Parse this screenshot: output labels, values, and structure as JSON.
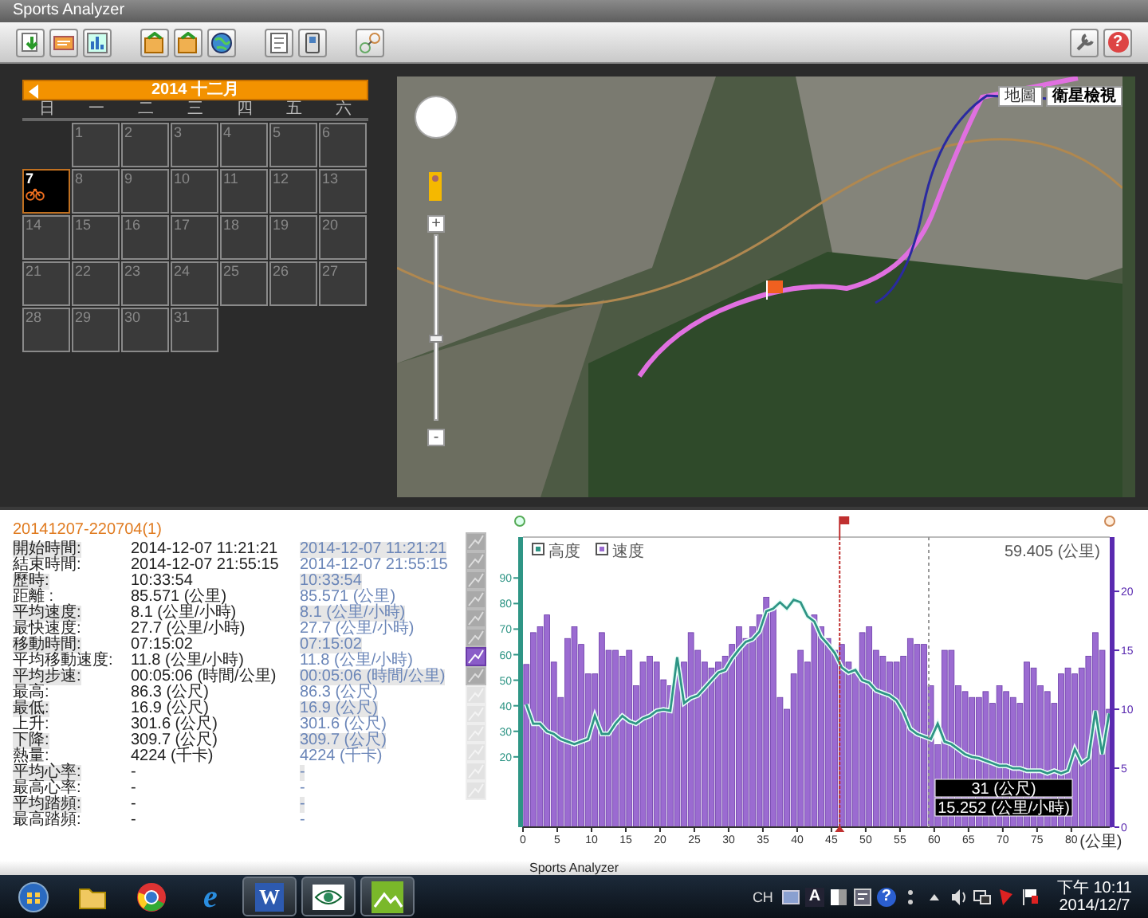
{
  "window": {
    "title": "Sports Analyzer"
  },
  "toolbar": {
    "groups": [
      [
        {
          "kind": "import"
        },
        {
          "kind": "card"
        },
        {
          "kind": "chart"
        }
      ],
      [
        {
          "kind": "export"
        },
        {
          "kind": "export"
        },
        {
          "kind": "globe"
        }
      ],
      [
        {
          "kind": "document"
        },
        {
          "kind": "device"
        }
      ],
      [
        {
          "kind": "chain"
        }
      ]
    ],
    "right": [
      {
        "kind": "wrench"
      },
      {
        "kind": "help",
        "glyph": "?"
      }
    ]
  },
  "calendar": {
    "month": "2014 十二月",
    "weekdays": [
      "日",
      "一",
      "二",
      "三",
      "四",
      "五",
      "六"
    ],
    "weeks": [
      [
        {
          "kind": "blank"
        },
        {
          "kind": "day",
          "day": "1",
          "selected": false,
          "has_activity": false
        },
        {
          "kind": "day",
          "day": "2",
          "selected": false,
          "has_activity": false
        },
        {
          "kind": "day",
          "day": "3",
          "selected": false,
          "has_activity": false
        },
        {
          "kind": "day",
          "day": "4",
          "selected": false,
          "has_activity": false
        },
        {
          "kind": "day",
          "day": "5",
          "selected": false,
          "has_activity": false
        },
        {
          "kind": "day",
          "day": "6",
          "selected": false,
          "has_activity": false
        }
      ],
      [
        {
          "kind": "day",
          "day": "7",
          "selected": true,
          "has_activity": true
        },
        {
          "kind": "day",
          "day": "8",
          "selected": false,
          "has_activity": false
        },
        {
          "kind": "day",
          "day": "9",
          "selected": false,
          "has_activity": false
        },
        {
          "kind": "day",
          "day": "10",
          "selected": false,
          "has_activity": false
        },
        {
          "kind": "day",
          "day": "11",
          "selected": false,
          "has_activity": false
        },
        {
          "kind": "day",
          "day": "12",
          "selected": false,
          "has_activity": false
        },
        {
          "kind": "day",
          "day": "13",
          "selected": false,
          "has_activity": false
        }
      ],
      [
        {
          "kind": "day",
          "day": "14",
          "selected": false,
          "has_activity": false
        },
        {
          "kind": "day",
          "day": "15",
          "selected": false,
          "has_activity": false
        },
        {
          "kind": "day",
          "day": "16",
          "selected": false,
          "has_activity": false
        },
        {
          "kind": "day",
          "day": "17",
          "selected": false,
          "has_activity": false
        },
        {
          "kind": "day",
          "day": "18",
          "selected": false,
          "has_activity": false
        },
        {
          "kind": "day",
          "day": "19",
          "selected": false,
          "has_activity": false
        },
        {
          "kind": "day",
          "day": "20",
          "selected": false,
          "has_activity": false
        }
      ],
      [
        {
          "kind": "day",
          "day": "21",
          "selected": false,
          "has_activity": false
        },
        {
          "kind": "day",
          "day": "22",
          "selected": false,
          "has_activity": false
        },
        {
          "kind": "day",
          "day": "23",
          "selected": false,
          "has_activity": false
        },
        {
          "kind": "day",
          "day": "24",
          "selected": false,
          "has_activity": false
        },
        {
          "kind": "day",
          "day": "25",
          "selected": false,
          "has_activity": false
        },
        {
          "kind": "day",
          "day": "26",
          "selected": false,
          "has_activity": false
        },
        {
          "kind": "day",
          "day": "27",
          "selected": false,
          "has_activity": false
        }
      ],
      [
        {
          "kind": "day",
          "day": "28",
          "selected": false,
          "has_activity": false
        },
        {
          "kind": "day",
          "day": "29",
          "selected": false,
          "has_activity": false
        },
        {
          "kind": "day",
          "day": "30",
          "selected": false,
          "has_activity": false
        },
        {
          "kind": "day",
          "day": "31",
          "selected": false,
          "has_activity": false
        }
      ]
    ]
  },
  "map": {
    "zoom_in": "+",
    "zoom_out": "-",
    "zoom_slider": {
      "level": 0.46
    },
    "map_types": [
      {
        "label": "地圖",
        "selected": false
      },
      {
        "label": "衛星檢視",
        "selected": true
      }
    ]
  },
  "session": {
    "title": "20141207-220704(1)",
    "rows": [
      {
        "label": "開始時間:",
        "value": "2014-12-07 11:21:21",
        "compare": "2014-12-07 11:21:21"
      },
      {
        "label": "結束時間:",
        "value": "2014-12-07 21:55:15",
        "compare": "2014-12-07 21:55:15"
      },
      {
        "label": "歷時:",
        "value": "10:33:54",
        "compare": "10:33:54"
      },
      {
        "label": "距離 :",
        "value": "85.571 (公里)",
        "compare": "85.571 (公里)"
      },
      {
        "label": "平均速度:",
        "value": "8.1 (公里/小時)",
        "compare": "8.1 (公里/小時)"
      },
      {
        "label": "最快速度:",
        "value": "27.7 (公里/小時)",
        "compare": "27.7 (公里/小時)"
      },
      {
        "label": "移動時間:",
        "value": "07:15:02",
        "compare": "07:15:02"
      },
      {
        "label": "平均移動速度:",
        "value": "11.8 (公里/小時)",
        "compare": "11.8 (公里/小時)"
      },
      {
        "label": "平均步速:",
        "value": "00:05:06 (時間/公里)",
        "compare": "00:05:06 (時間/公里)"
      },
      {
        "label": "最高:",
        "value": "86.3 (公尺)",
        "compare": "86.3 (公尺)"
      },
      {
        "label": "最低:",
        "value": "16.9 (公尺)",
        "compare": "16.9 (公尺)"
      },
      {
        "label": "上升:",
        "value": "301.6 (公尺)",
        "compare": "301.6 (公尺)"
      },
      {
        "label": "下降:",
        "value": "309.7 (公尺)",
        "compare": "309.7 (公尺)"
      },
      {
        "label": "熱量:",
        "value": "4224 (千卡)",
        "compare": "4224 (千卡)"
      },
      {
        "label": "平均心率:",
        "value": "-",
        "compare": "-"
      },
      {
        "label": "最高心率:",
        "value": "-",
        "compare": "-"
      },
      {
        "label": "平均踏頻:",
        "value": "-",
        "compare": "-"
      },
      {
        "label": "最高踏頻:",
        "value": "-",
        "compare": "-"
      }
    ]
  },
  "chart_tools": [
    {
      "selected": false,
      "disabled": false
    },
    {
      "selected": false,
      "disabled": false
    },
    {
      "selected": false,
      "disabled": false
    },
    {
      "selected": false,
      "disabled": false
    },
    {
      "selected": false,
      "disabled": false
    },
    {
      "selected": false,
      "disabled": false
    },
    {
      "selected": true,
      "disabled": false
    },
    {
      "selected": false,
      "disabled": false
    },
    {
      "selected": false,
      "disabled": true
    },
    {
      "selected": false,
      "disabled": true
    },
    {
      "selected": false,
      "disabled": true
    },
    {
      "selected": false,
      "disabled": true
    },
    {
      "selected": false,
      "disabled": true
    },
    {
      "selected": false,
      "disabled": true
    }
  ],
  "chart": {
    "reading": "59.405 (公里)",
    "tooltip": [
      "31 (公尺)",
      "15.252 (公里/小時)"
    ],
    "chart_data": {
      "type": "bar",
      "xlabel": "(公里)",
      "x": [
        0.5,
        1.5,
        2.5,
        3.5,
        4.5,
        5.5,
        6.5,
        7.5,
        8.5,
        9.5,
        10.5,
        11.5,
        12.5,
        13.5,
        14.5,
        15.5,
        16.5,
        17.5,
        18.5,
        19.5,
        20.5,
        21.5,
        22.5,
        23.5,
        24.5,
        25.5,
        26.5,
        27.5,
        28.5,
        29.5,
        30.5,
        31.5,
        32.5,
        33.5,
        34.5,
        35.5,
        36.5,
        37.5,
        38.5,
        39.5,
        40.5,
        41.5,
        42.5,
        43.5,
        44.5,
        45.5,
        46.5,
        47.5,
        48.5,
        49.5,
        50.5,
        51.5,
        52.5,
        53.5,
        54.5,
        55.5,
        56.5,
        57.5,
        58.5,
        59.5,
        60.5,
        61.5,
        62.5,
        63.5,
        64.5,
        65.5,
        66.5,
        67.5,
        68.5,
        69.5,
        70.5,
        71.5,
        72.5,
        73.5,
        74.5,
        75.5,
        76.5,
        77.5,
        78.5,
        79.5,
        80.5,
        81.5,
        82.5,
        83.5,
        84.5,
        85.5
      ],
      "series": [
        {
          "name": "高度",
          "color": "#2e9585",
          "type": "line",
          "values": [
            40.6,
            33,
            33,
            30,
            29,
            27,
            26,
            25,
            26,
            27,
            36,
            29,
            29,
            33,
            36,
            34,
            33,
            35,
            36,
            38,
            38.5,
            38,
            59,
            41,
            43,
            44,
            47,
            50,
            53,
            54,
            58.5,
            62,
            65,
            66,
            69,
            77,
            78,
            80.5,
            78,
            81.5,
            80.5,
            75,
            73,
            67,
            64,
            60.6,
            55,
            53,
            54,
            50,
            49,
            46,
            45,
            44,
            42,
            37.5,
            31,
            29,
            28,
            27,
            33,
            26,
            25,
            23,
            21,
            20,
            19.5,
            18.5,
            17.5,
            16.5,
            16.5,
            15.5,
            15.5,
            14.6,
            14.6,
            14.6,
            13.5,
            14.6,
            13.5,
            14.6,
            23,
            17.5,
            19.5,
            38,
            21,
            37
          ]
        },
        {
          "name": "速度",
          "color": "#9b6bd1",
          "axis": "y2",
          "values": [
            13.8,
            16.5,
            17,
            18,
            14,
            11,
            16,
            17,
            15.5,
            13,
            13,
            16.5,
            15,
            15,
            14.5,
            15,
            12,
            14,
            14.5,
            14,
            12.5,
            12,
            13,
            14,
            16.5,
            15,
            14,
            13.5,
            14,
            14.5,
            15.5,
            17,
            16,
            17,
            18,
            19.5,
            18.5,
            11,
            10,
            13,
            15,
            14,
            18,
            17,
            16,
            15,
            15.5,
            14,
            13,
            16.5,
            17,
            15,
            14.5,
            14,
            14,
            14.5,
            16,
            15.5,
            15.5,
            12,
            7,
            15,
            15,
            12,
            11.5,
            11,
            11,
            11.5,
            10.5,
            12,
            11.5,
            11,
            10.5,
            14,
            13.5,
            12,
            11.5,
            10.5,
            13,
            13.5,
            13,
            13.5,
            14.5,
            16.5,
            15,
            10
          ]
        }
      ],
      "xlim": [
        0,
        85.6
      ],
      "ylim": [
        -7.5,
        106
      ],
      "y2lim": [
        0,
        24.6
      ],
      "xticks": [
        0,
        5,
        10,
        15,
        20,
        25,
        30,
        35,
        40,
        45,
        50,
        55,
        60,
        65,
        70,
        75,
        80
      ],
      "yticks": [
        20,
        30,
        40,
        50,
        60,
        70,
        80,
        90
      ],
      "y2ticks": [
        0,
        5,
        10,
        15,
        20
      ],
      "legend": "upper left",
      "ref_lines": [
        {
          "axis": "x",
          "value": 46.2,
          "color": "#c03030"
        },
        {
          "axis": "x",
          "value": 59.2,
          "color": "#999999"
        }
      ]
    }
  },
  "status_bar": {
    "title": "Sports Analyzer"
  },
  "taskbar": {
    "items": [
      {
        "kind": "start",
        "running": false
      },
      {
        "kind": "folder",
        "running": false
      },
      {
        "kind": "browser",
        "running": false
      },
      {
        "kind": "ie",
        "glyph": "e",
        "running": false
      },
      {
        "kind": "word",
        "glyph": "W",
        "running": true
      },
      {
        "kind": "eye",
        "running": true
      },
      {
        "kind": "mountain",
        "running": true
      }
    ],
    "tray": {
      "language": "CH",
      "icons": [
        {
          "kind": "keyboard"
        },
        {
          "kind": "letter",
          "glyph": "A"
        },
        {
          "kind": "panel"
        },
        {
          "kind": "tablet"
        },
        {
          "kind": "help",
          "glyph": "?"
        },
        {
          "kind": "dots"
        },
        {
          "kind": "triangle"
        },
        {
          "kind": "speaker"
        },
        {
          "kind": "network"
        },
        {
          "kind": "redflag"
        },
        {
          "kind": "flag"
        }
      ],
      "time": "下午 10:11",
      "date": "2014/12/7"
    }
  }
}
